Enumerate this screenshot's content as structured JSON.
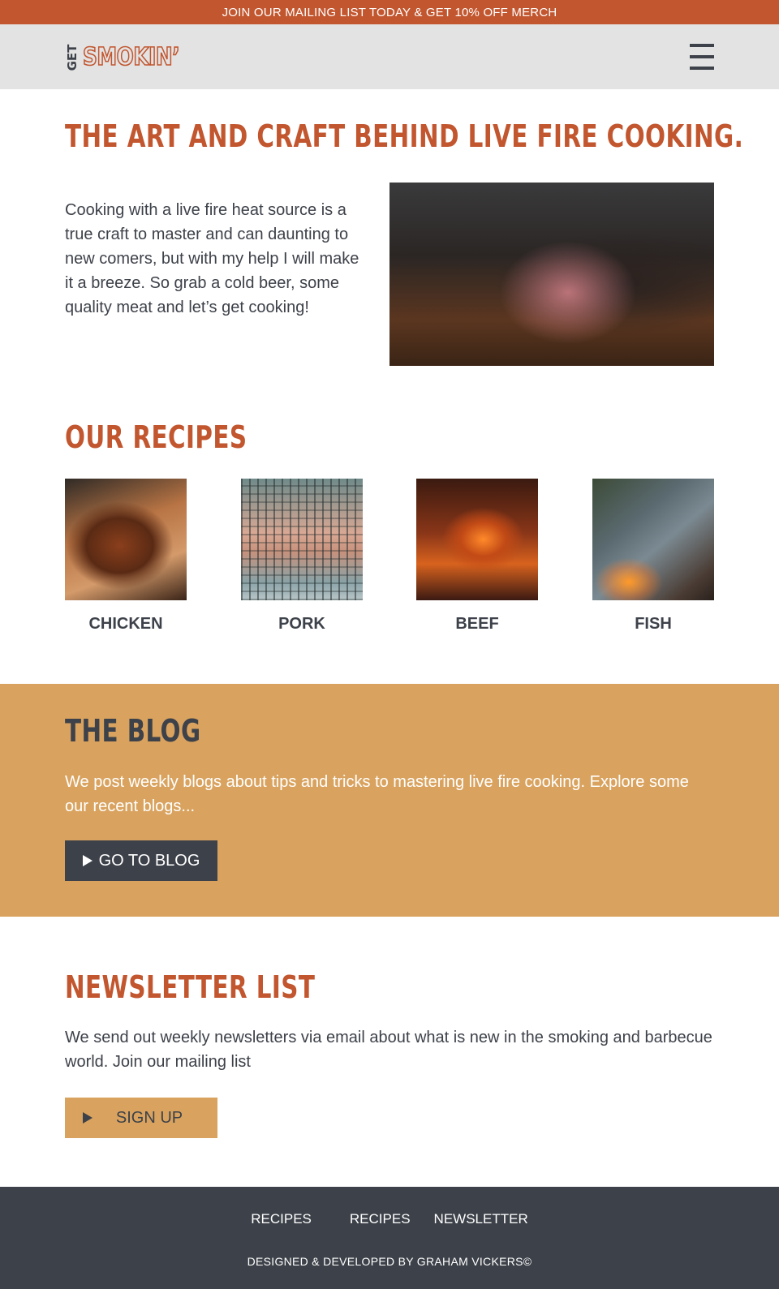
{
  "promo": {
    "text": "JOIN OUR MAILING LIST TODAY & GET 10% OFF MERCH"
  },
  "header": {
    "logo_small": "GET",
    "logo_main": "SMOKIN’",
    "menu_icon": "hamburger-menu-icon"
  },
  "hero": {
    "title": "THE ART AND CRAFT BEHIND LIVE FIRE COOKING.",
    "intro": "Cooking with a live fire heat source is a true craft to master and can daunting to new comers, but with my help I will make it a breeze. So grab a cold beer, some quality meat and let’s get cooking!"
  },
  "recipes": {
    "title": "OUR RECIPES",
    "items": [
      {
        "label": "CHICKEN"
      },
      {
        "label": "PORK"
      },
      {
        "label": "BEEF"
      },
      {
        "label": "FISH"
      }
    ]
  },
  "blog": {
    "title": "THE BLOG",
    "text": "We post weekly blogs about tips and tricks to mastering live fire cooking. Explore some our recent blogs...",
    "button_label": "GO TO BLOG",
    "button_icon": "play-icon"
  },
  "newsletter": {
    "title": "NEWSLETTER LIST",
    "text": "We send out weekly newsletters via email about what is new in the smoking and barbecue world. Join our mailing list",
    "button_label": "SIGN UP",
    "button_icon": "play-icon"
  },
  "footer": {
    "links": [
      "RECIPES",
      "RECIPES",
      "NEWSLETTER"
    ],
    "credit": "DESIGNED & DEVELOPED BY GRAHAM VICKERS©"
  },
  "colors": {
    "brand_orange": "#c2562f",
    "accent_tan": "#d9a35f",
    "dark_slate": "#3d4149",
    "header_gray": "#e3e3e3"
  }
}
